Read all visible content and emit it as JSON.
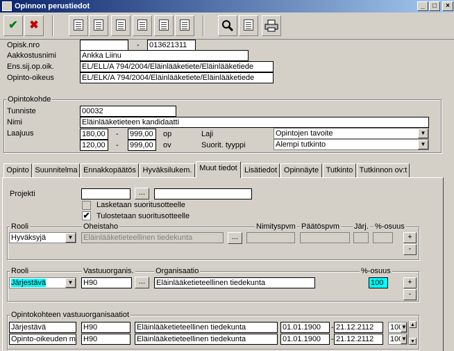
{
  "window": {
    "title": "Opinnon perustiedot",
    "minimize": "_",
    "maximize": "□",
    "close": "×"
  },
  "toolbar": {
    "save_icon": "✔",
    "cancel_icon": "✖"
  },
  "header": {
    "opisk_nro_label": "Opisk.nro",
    "opisk_nro_value": "",
    "dash": "-",
    "opisk_nro_value2": "013621311",
    "name_label": "Aakkostusnimi",
    "name_value": "Ankka Liinu",
    "ens_label": "Ens.sij.op.oik.",
    "ens_value": "EL/ELL/A 794/2004/Eläinlääketiete/Eläinlääketiede",
    "oikeus_label": "Opinto-oikeus",
    "oikeus_value": "EL/ELK/A 794/2004/Eläinlääketiete/Eläinlääketiede"
  },
  "opintokohde": {
    "legend": "Opintokohde",
    "tunniste_label": "Tunniste",
    "tunniste_value": "00032",
    "nimi_label": "Nimi",
    "nimi_value": "Eläinlääketieteen kandidaatti",
    "laajuus_label": "Laajuus",
    "row1_min": "180,00",
    "row1_dash": "-",
    "row1_max": "999,00",
    "row1_unit": "op",
    "row2_min": "120,00",
    "row2_dash": "-",
    "row2_max": "999,00",
    "row2_unit": "ov",
    "laji_label": "Laji",
    "laji_value": "Opintojen tavoite",
    "suorit_label": "Suorit. tyyppi",
    "suorit_value": "Alempi tutkinto"
  },
  "tabs": [
    {
      "label": "Opinto"
    },
    {
      "label": "Suunnitelma"
    },
    {
      "label": "Ennakkopäätös"
    },
    {
      "label": "Hyväksilukem."
    },
    {
      "label": "Muut tiedot"
    },
    {
      "label": "Lisätiedot"
    },
    {
      "label": "Opinnäyte"
    },
    {
      "label": "Tutkinto"
    },
    {
      "label": "Tutkinnon ov:t"
    }
  ],
  "muut": {
    "projekti_label": "Projekti",
    "projekti_value": "",
    "projekti_name": "",
    "ellipsis": "...",
    "lasketaan_label": "Lasketaan suoritusotteelle",
    "tulostetaan_label": "Tulostetaan suoritusotteelle",
    "tulostetaan_checked": "✔"
  },
  "group1": {
    "rooli_label": "Rooli",
    "rooli_value": "Hyväksyjä",
    "oheistaho_label": "Oheistaho",
    "oheistaho_value": "Eläinlääketieteellinen tiedekunta",
    "nimitys_label": "Nimityspvm",
    "paatos_label": "Päätöspvm",
    "jarj_label": "Järj.",
    "osuus_label": "%-osuus",
    "plus": "+",
    "minus": "-"
  },
  "group2": {
    "rooli_label": "Rooli",
    "rooli_value": "Järjestävä",
    "vastuu_label": "Vastuuorganis.",
    "vastuu_value": "H90",
    "org_label": "Organisaatio",
    "org_value": "Eläinlääketieteellinen tiedekunta",
    "osuus_label": "%-osuus",
    "osuus_value": "100",
    "plus": "+",
    "minus": "-"
  },
  "group3": {
    "legend": "Opintokohteen vastuuorganisaatiot",
    "rows": [
      {
        "rooli": "Järjestävä",
        "code": "H90",
        "org": "Eläinlääketieteellinen tiedekunta",
        "start": "01.01.1900",
        "dash": "-",
        "end": "21.12.2112",
        "pct": "100"
      },
      {
        "rooli": "Opinto-oikeuden my",
        "code": "H90",
        "org": "Eläinlääketieteellinen tiedekunta",
        "start": "01.01.1900",
        "dash": "-",
        "end": "21.12.2112",
        "pct": "100"
      }
    ]
  }
}
